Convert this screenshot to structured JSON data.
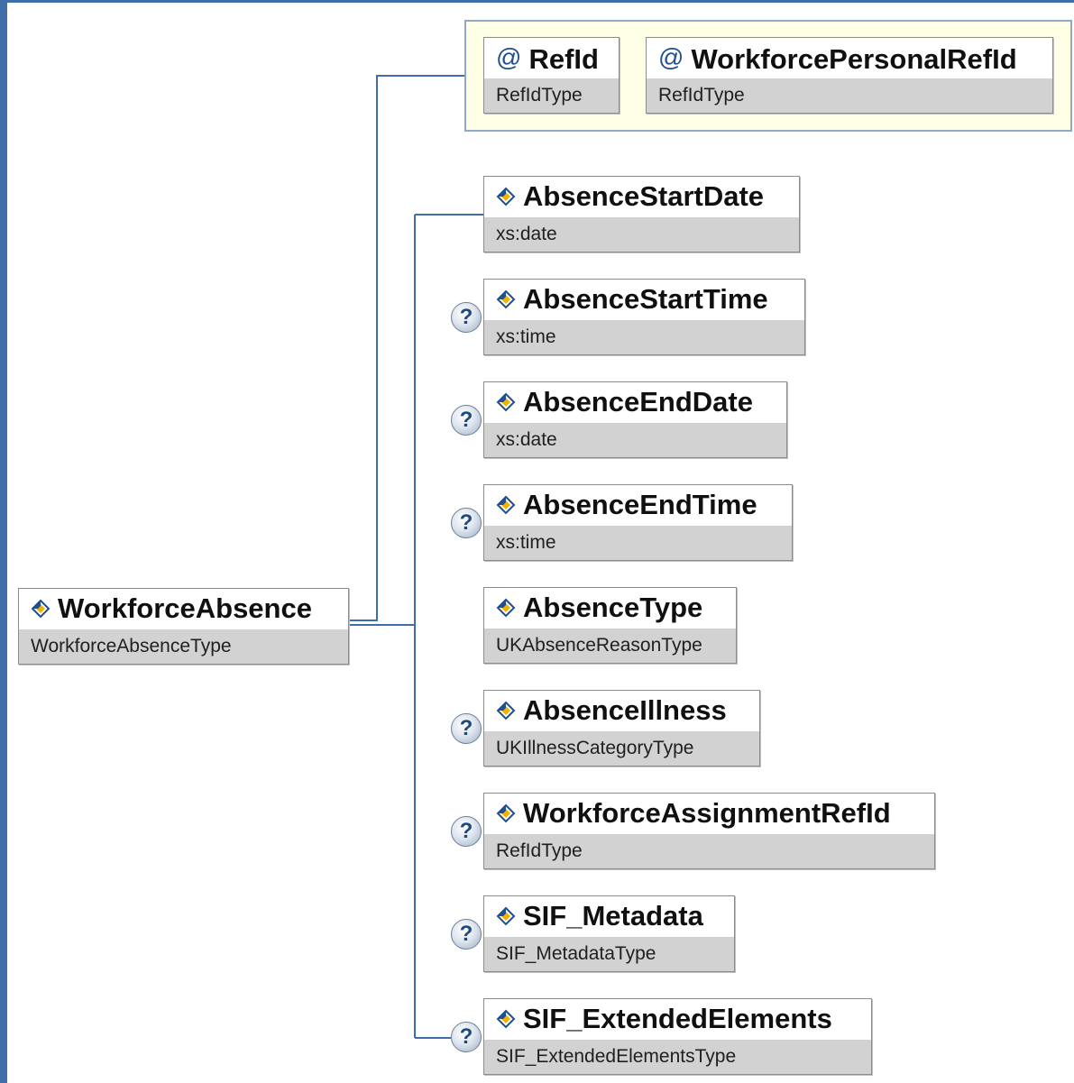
{
  "root": {
    "name": "WorkforceAbsence",
    "type": "WorkforceAbsenceType"
  },
  "attributes": [
    {
      "name": "RefId",
      "type": "RefIdType"
    },
    {
      "name": "WorkforcePersonalRefId",
      "type": "RefIdType"
    }
  ],
  "attribute_icon": "@",
  "optional_marker": "?",
  "elements": [
    {
      "name": "AbsenceStartDate",
      "type": "xs:date",
      "optional": false
    },
    {
      "name": "AbsenceStartTime",
      "type": "xs:time",
      "optional": true
    },
    {
      "name": "AbsenceEndDate",
      "type": "xs:date",
      "optional": true
    },
    {
      "name": "AbsenceEndTime",
      "type": "xs:time",
      "optional": true
    },
    {
      "name": "AbsenceType",
      "type": "UKAbsenceReasonType",
      "optional": false
    },
    {
      "name": "AbsenceIllness",
      "type": "UKIllnessCategoryType",
      "optional": true
    },
    {
      "name": "WorkforceAssignmentRefId",
      "type": "RefIdType",
      "optional": true
    },
    {
      "name": "SIF_Metadata",
      "type": "SIF_MetadataType",
      "optional": true
    },
    {
      "name": "SIF_ExtendedElements",
      "type": "SIF_ExtendedElementsType",
      "optional": true
    }
  ],
  "colors": {
    "frame": "#3f6ea8",
    "attribute_group_bg": "#ffffe6",
    "type_bar": "#d2d2d2",
    "connector": "#3f6ea8"
  }
}
